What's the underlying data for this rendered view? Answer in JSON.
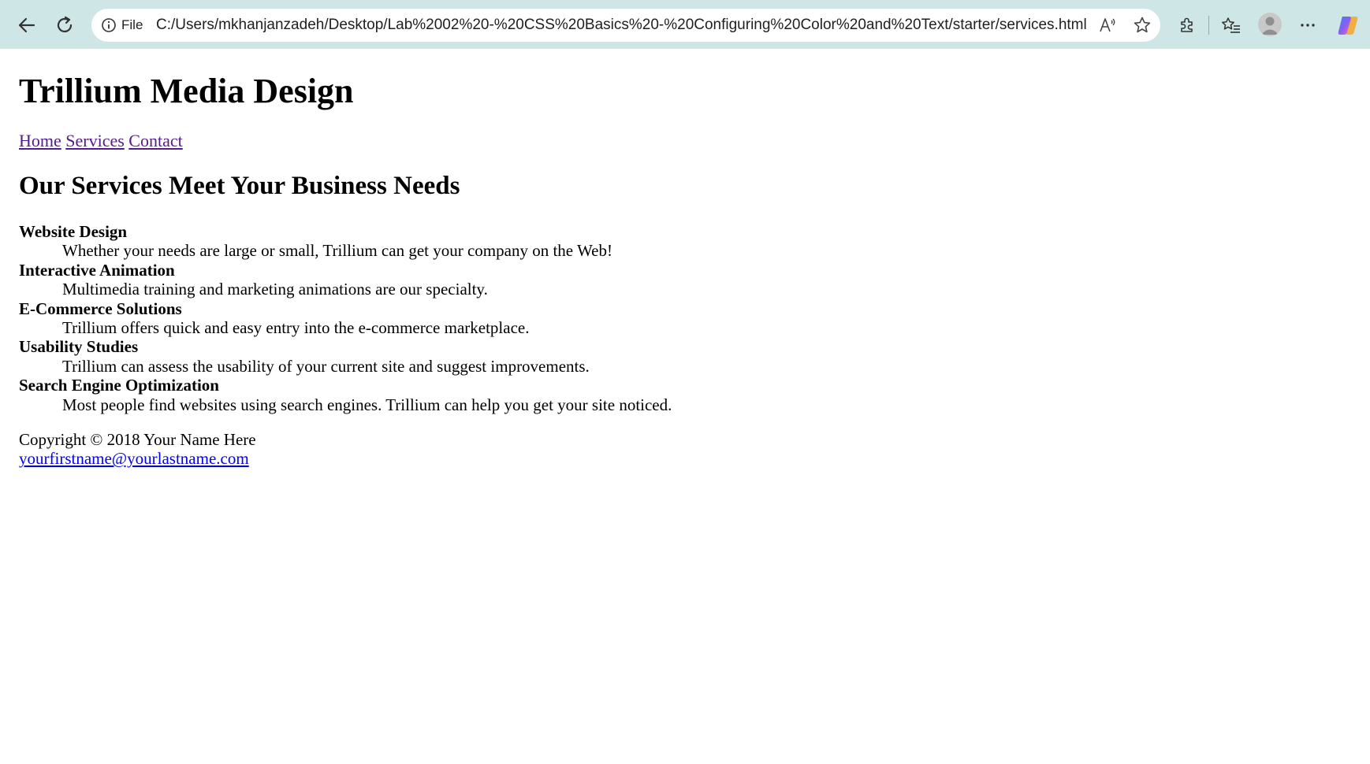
{
  "browser": {
    "address_prefix": "File",
    "url": "C:/Users/mkhanjanzadeh/Desktop/Lab%2002%20-%20CSS%20Basics%20-%20Configuring%20Color%20and%20Text/starter/services.html",
    "icons": {
      "back": "back-arrow-icon",
      "refresh": "refresh-icon",
      "info": "info-icon",
      "read_aloud": "read-aloud-icon",
      "favorite": "star-icon",
      "extensions": "extensions-icon",
      "favorites": "favorites-icon",
      "profile": "profile-icon",
      "more": "more-icon",
      "copilot": "copilot-icon"
    },
    "chrome_color": "#cfe6e6"
  },
  "page": {
    "site_title": "Trillium Media Design",
    "nav": [
      {
        "label": "Home"
      },
      {
        "label": "Services"
      },
      {
        "label": "Contact"
      }
    ],
    "section_title": "Our Services Meet Your Business Needs",
    "services": [
      {
        "term": "Website Design",
        "description": "Whether your needs are large or small, Trillium can get your company on the Web!"
      },
      {
        "term": "Interactive Animation",
        "description": "Multimedia training and marketing animations are our specialty."
      },
      {
        "term": "E-Commerce Solutions",
        "description": "Trillium offers quick and easy entry into the e-commerce marketplace."
      },
      {
        "term": "Usability Studies",
        "description": "Trillium can assess the usability of your current site and suggest improvements."
      },
      {
        "term": "Search Engine Optimization",
        "description": "Most people find websites using search engines. Trillium can help you get your site noticed."
      }
    ],
    "footer": {
      "copyright": "Copyright © 2018 Your Name Here",
      "email": "yourfirstname@yourlastname.com"
    },
    "colors": {
      "visited_link": "#551a8b",
      "link": "#0000ee"
    }
  }
}
